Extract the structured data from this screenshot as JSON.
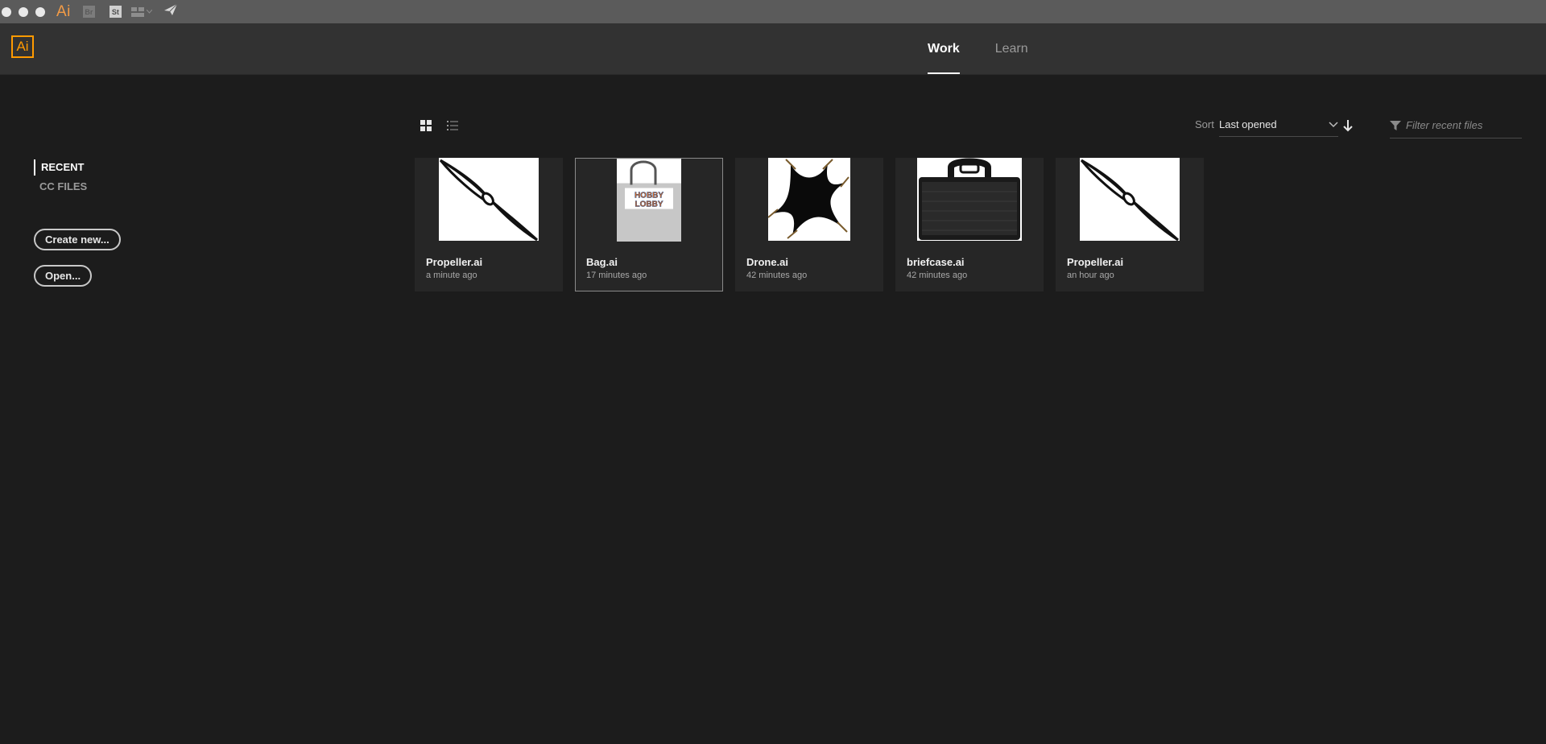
{
  "system_bar": {
    "app_label": "Ai",
    "br_label": "Br",
    "st_label": "St"
  },
  "header": {
    "logo": "Ai",
    "tabs": [
      {
        "label": "Work",
        "active": true
      },
      {
        "label": "Learn",
        "active": false
      }
    ]
  },
  "sidebar": {
    "recent": "RECENT",
    "cc_files": "CC FILES",
    "create_new": "Create new...",
    "open": "Open..."
  },
  "toolbar": {
    "sort_label": "Sort",
    "sort_value": "Last opened",
    "filter_placeholder": "Filter recent files"
  },
  "files": [
    {
      "name": "Propeller.ai",
      "time": "a minute ago",
      "thumb": "propeller",
      "selected": false
    },
    {
      "name": "Bag.ai",
      "time": "17 minutes ago",
      "thumb": "bag",
      "selected": true
    },
    {
      "name": "Drone.ai",
      "time": "42 minutes ago",
      "thumb": "drone",
      "selected": false
    },
    {
      "name": "briefcase.ai",
      "time": "42 minutes ago",
      "thumb": "briefcase",
      "selected": false
    },
    {
      "name": "Propeller.ai",
      "time": "an hour ago",
      "thumb": "propeller",
      "selected": false
    }
  ],
  "colors": {
    "accent": "#ff9a00",
    "background": "#1c1c1c",
    "header": "#323232"
  }
}
